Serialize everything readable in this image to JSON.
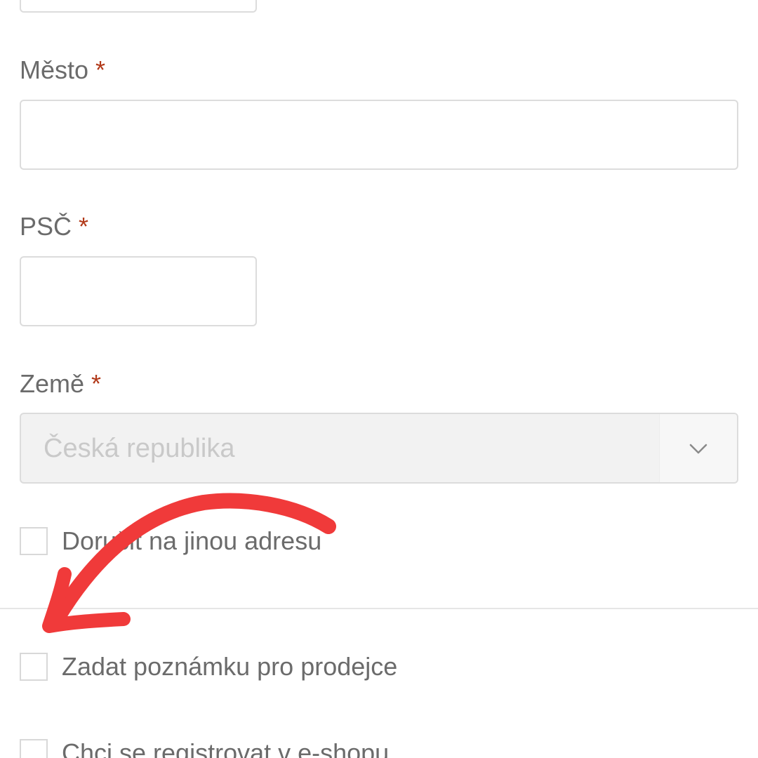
{
  "form": {
    "city": {
      "label": "Město",
      "required_mark": "*",
      "value": ""
    },
    "zip": {
      "label": "PSČ",
      "required_mark": "*",
      "value": ""
    },
    "country": {
      "label": "Země",
      "required_mark": "*",
      "selected": "Česká republika"
    },
    "checkboxes": [
      {
        "label": "Doručit na jinou adresu",
        "checked": false
      },
      {
        "label": "Zadat poznámku pro prodejce",
        "checked": false
      },
      {
        "label": "Chci se registrovat v e-shopu",
        "checked": false
      }
    ]
  },
  "annotation": {
    "arrow_color": "#f03a3a"
  },
  "colors": {
    "required": "#b23a1a",
    "label": "#6b6b6b",
    "border": "#dcdcdc",
    "select_bg": "#f2f2f2"
  }
}
